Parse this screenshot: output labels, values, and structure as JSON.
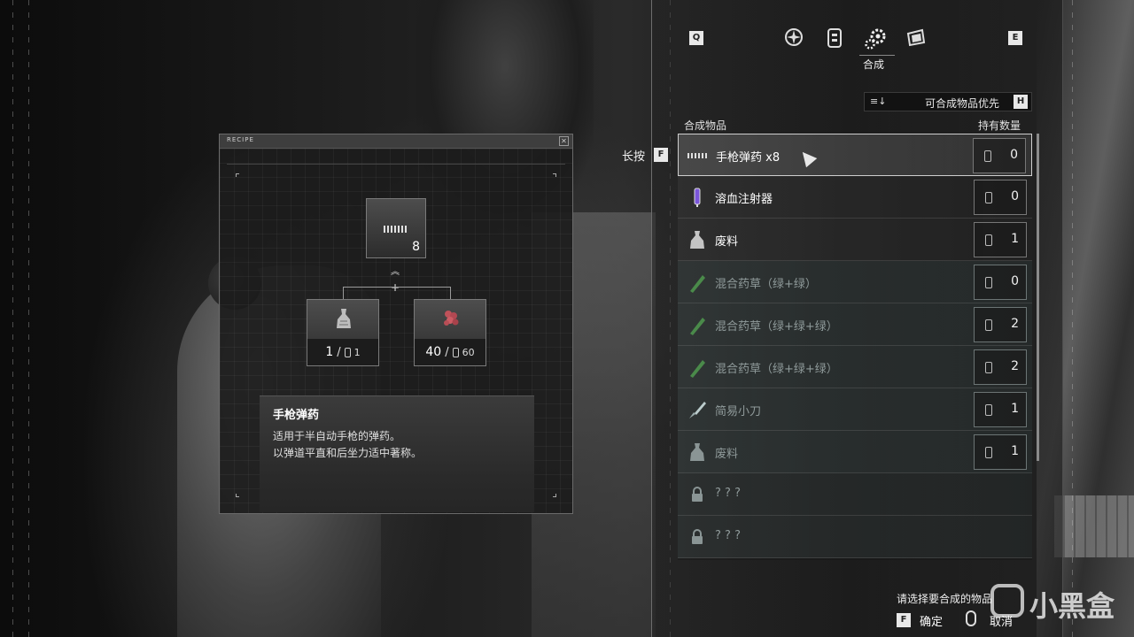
{
  "recipe_panel": {
    "title": "RECIPE",
    "close_glyph": "✕",
    "result_quantity": "8",
    "ingredients": [
      {
        "owned": "1",
        "separator": "/",
        "required": "1"
      },
      {
        "owned": "40",
        "separator": "/",
        "required": "60"
      }
    ],
    "chevron_glyph": "︽",
    "plus_glyph": "+",
    "description": {
      "title": "手枪弹药",
      "line1": "适用于半自动手枪的弹药。",
      "line2": "以弹道平直和后坐力适中著称。"
    }
  },
  "tabs": {
    "left_key": "Q",
    "right_key": "E",
    "active_label": "合成",
    "icons": [
      "map-icon",
      "files-icon",
      "craft-gears-icon",
      "inventory-icon"
    ]
  },
  "sort": {
    "label": "可合成物品优先",
    "key": "H",
    "icon_glyph": "≡↓"
  },
  "list": {
    "header_left": "合成物品",
    "header_right": "持有数量",
    "hold_label": "长按",
    "hold_key": "F",
    "rows": [
      {
        "name": "手枪弹药 x8",
        "count": "0",
        "state": "selected",
        "icon": "ammo-icon"
      },
      {
        "name": "溶血注射器",
        "count": "0",
        "state": "normal",
        "icon": "injector-icon"
      },
      {
        "name": "废料",
        "count": "1",
        "state": "normal",
        "icon": "scrap-icon"
      },
      {
        "name": "混合药草（绿+绿）",
        "count": "0",
        "state": "dim",
        "icon": "herb-icon"
      },
      {
        "name": "混合药草（绿+绿+绿）",
        "count": "2",
        "state": "dim",
        "icon": "herb-icon"
      },
      {
        "name": "混合药草（绿+绿+绿）",
        "count": "2",
        "state": "dim",
        "icon": "herb-icon"
      },
      {
        "name": "简易小刀",
        "count": "1",
        "state": "dim",
        "icon": "knife-icon"
      },
      {
        "name": "废料",
        "count": "1",
        "state": "dim",
        "icon": "scrap-icon"
      },
      {
        "name": "? ? ?",
        "count": "",
        "state": "locked",
        "icon": "lock-icon"
      },
      {
        "name": "? ? ?",
        "count": "",
        "state": "locked",
        "icon": "lock-icon"
      }
    ]
  },
  "footer": {
    "hint": "请选择要合成的物品",
    "confirm_key": "F",
    "confirm_label": "确定",
    "cancel_label": "取消"
  },
  "watermark": {
    "text": "小黑盒"
  },
  "colors": {
    "panel_border": "#6a6a6a",
    "selected_border": "#cfcfcf",
    "dim_text": "#8f9a9a",
    "herb_green": "#4a8a4a",
    "injector_purple": "#7a55d9",
    "ammo_pellet_red": "#c0525a"
  }
}
